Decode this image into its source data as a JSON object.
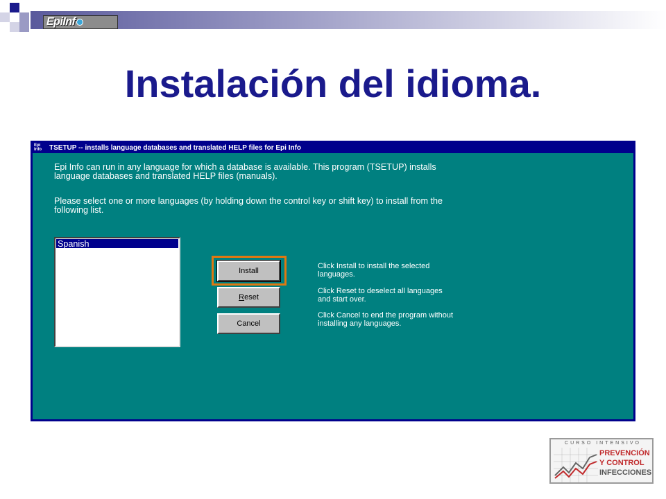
{
  "slide": {
    "title": "Instalación del idioma.",
    "logo_text": "EpiInf"
  },
  "window": {
    "icon_text": "Epi Info",
    "title": "TSETUP -- installs language databases and translated HELP files for Epi Info",
    "description_1": "Epi Info can run in any language for which a database is available.  This program (TSETUP) installs language databases and translated HELP files (manuals).",
    "description_2": "Please select one or more languages (by holding down the control key or shift key) to install from the following list.",
    "languages": [
      "Spanish"
    ],
    "buttons": {
      "install": "Install",
      "reset_first": "R",
      "reset_rest": "eset",
      "cancel": "Cancel"
    },
    "help": {
      "install": "Click Install to install the selected languages.",
      "reset": "Click Reset to deselect all languages and start over.",
      "cancel": "Click Cancel to end the program without installing any languages."
    }
  },
  "course_logo": {
    "top": "CURSO INTENSIVO",
    "line1": "PREVENCIÓN",
    "line2": "Y CONTROL",
    "line3": "INFECCIONES"
  },
  "colors": {
    "window_bg": "#008080",
    "titlebar": "#00008c",
    "title_text": "#1a1a8c",
    "focus_ring": "#e07810"
  }
}
